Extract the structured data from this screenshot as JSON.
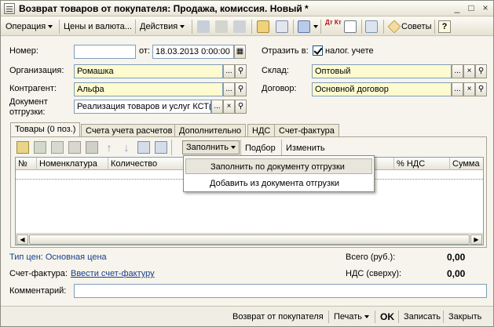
{
  "window": {
    "title": "Возврат товаров от покупателя: Продажа, комиссия. Новый *"
  },
  "toolbar": {
    "operation": "Операция",
    "prices_currency": "Цены и валюта...",
    "actions": "Действия",
    "tips": "Советы",
    "help": "?",
    "dtkt": "Дт Кт"
  },
  "form": {
    "number_label": "Номер:",
    "number_value": "",
    "from_label": "от:",
    "date_value": "18.03.2013  0:00:00",
    "reflect_label": "Отразить в:",
    "tax_accounting_label": "налог. учете",
    "organization_label": "Организация:",
    "organization_value": "Ромашка",
    "warehouse_label": "Склад:",
    "warehouse_value": "Оптовый",
    "counterparty_label": "Контрагент:",
    "counterparty_value": "Альфа",
    "contract_label": "Договор:",
    "contract_value": "Основной договор",
    "shipment_doc_label_1": "Документ",
    "shipment_doc_label_2": "отгрузки:",
    "shipment_doc_value": "Реализация товаров и услуг КСТ("
  },
  "tabs": [
    {
      "label": "Товары (0 поз.)"
    },
    {
      "label": "Счета учета расчетов"
    },
    {
      "label": "Дополнительно"
    },
    {
      "label": "НДС"
    },
    {
      "label": "Счет-фактура"
    }
  ],
  "table_toolbar": {
    "fill": "Заполнить",
    "selection": "Подбор",
    "change": "Изменить"
  },
  "grid": {
    "columns": [
      "№",
      "Номенклатура",
      "Количество",
      "% НДС",
      "Сумма"
    ]
  },
  "fill_menu": {
    "items": [
      "Заполнить по документу отгрузки",
      "Добавить из документа отгрузки"
    ]
  },
  "footer": {
    "price_type": "Тип цен: Основная цена",
    "total_label": "Всего (руб.):",
    "total_value": "0,00",
    "invoice_label": "Счет-фактура:",
    "invoice_link": "Ввести счет-фактуру",
    "vat_label": "НДС (сверху):",
    "vat_value": "0,00",
    "comment_label": "Комментарий:",
    "comment_value": ""
  },
  "bottom_buttons": {
    "return_from_buyer": "Возврат от покупателя",
    "print": "Печать",
    "ok": "OK",
    "save": "Записать",
    "close": "Закрыть"
  }
}
